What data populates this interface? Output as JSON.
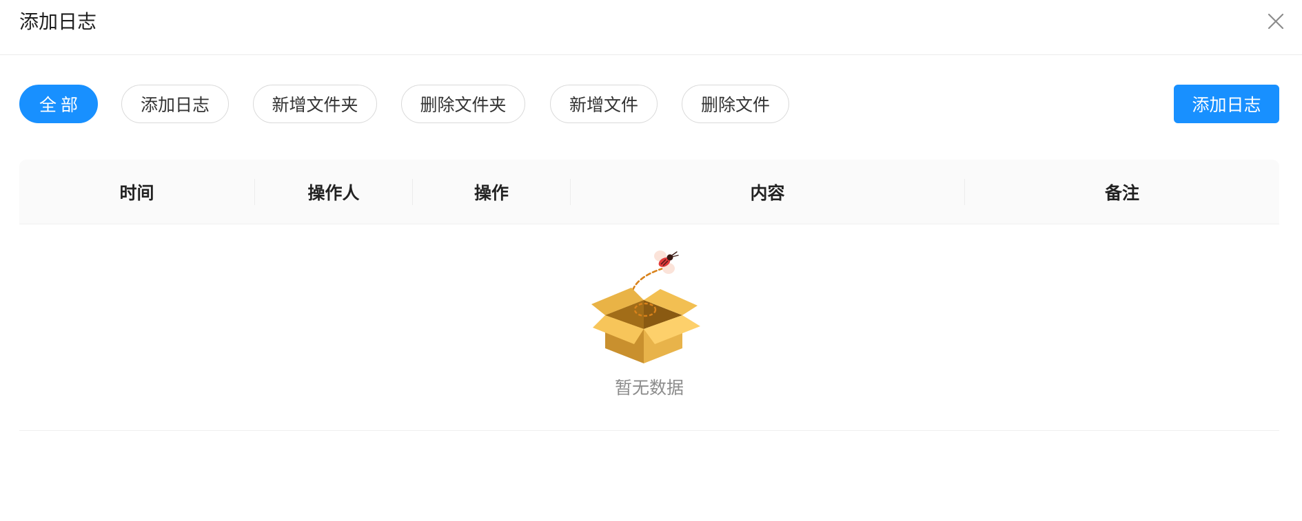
{
  "dialog": {
    "title": "添加日志"
  },
  "filters": {
    "tabs": [
      {
        "label": "全部",
        "active": true
      },
      {
        "label": "添加日志",
        "active": false
      },
      {
        "label": "新增文件夹",
        "active": false
      },
      {
        "label": "删除文件夹",
        "active": false
      },
      {
        "label": "新增文件",
        "active": false
      },
      {
        "label": "删除文件",
        "active": false
      }
    ],
    "add_button_label": "添加日志"
  },
  "table": {
    "columns": [
      "时间",
      "操作人",
      "操作",
      "内容",
      "备注"
    ],
    "rows": [],
    "empty_text": "暂无数据"
  },
  "colors": {
    "primary": "#1890ff",
    "header_bg": "#fafafa",
    "border": "#d9d9d9",
    "muted_text": "#8c8c8c"
  },
  "icons": {
    "close": "close-icon",
    "empty": "empty-box-icon"
  }
}
